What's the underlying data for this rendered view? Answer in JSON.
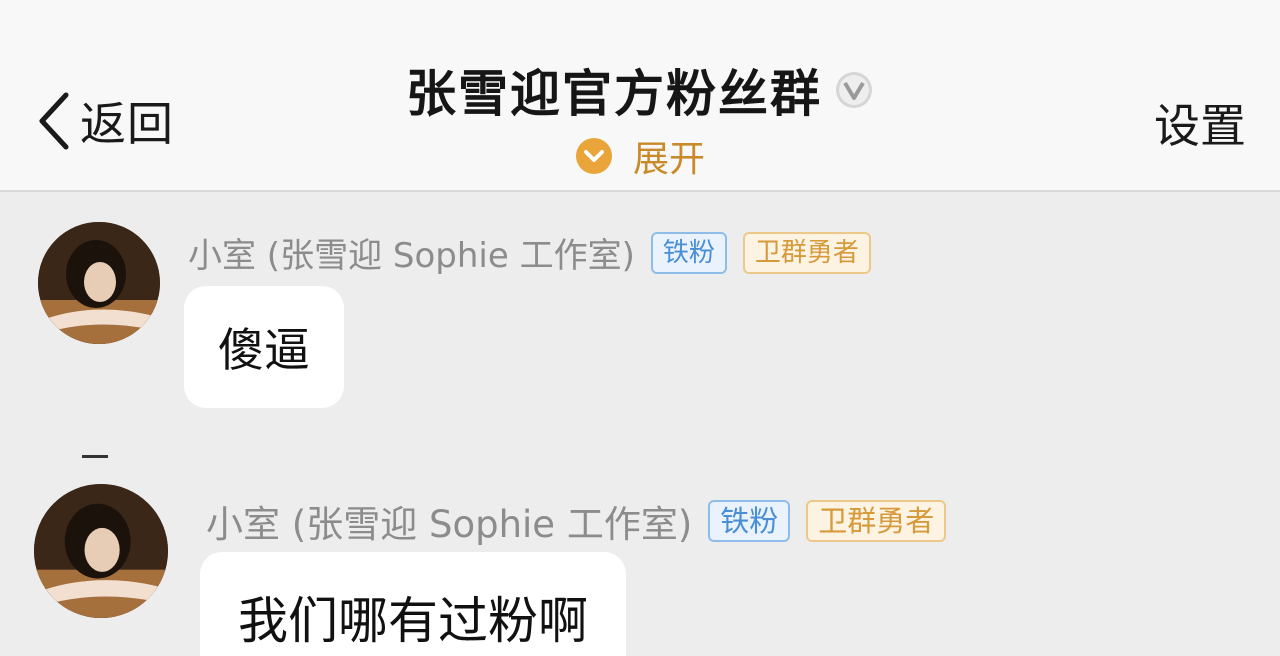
{
  "header": {
    "back_label": "返回",
    "title": "张雪迎官方粉丝群",
    "expand_label": "展开",
    "settings_label": "设置"
  },
  "messages": [
    {
      "sender": "小室 (张雪迎 Sophie 工作室)",
      "badges": [
        "铁粉",
        "卫群勇者"
      ],
      "text": "傻逼"
    },
    {
      "sender": "小室 (张雪迎 Sophie 工作室)",
      "badges": [
        "铁粉",
        "卫群勇者"
      ],
      "text": "我们哪有过粉啊"
    }
  ],
  "colors": {
    "header_bg": "#f8f8f8",
    "chat_bg": "#ededed",
    "bubble_bg": "#ffffff",
    "expand_accent": "#e9a43a",
    "iron_badge": "#4a8fd6",
    "guard_badge": "#d69a3a"
  },
  "icons": {
    "back": "chevron-left-icon",
    "verified": "verified-v-icon",
    "expand": "chevron-down-circle-icon"
  }
}
